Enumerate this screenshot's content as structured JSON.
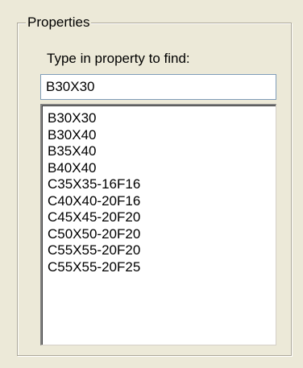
{
  "group": {
    "title": "Properties"
  },
  "search": {
    "prompt": "Type in property to find:",
    "value": "B30X30"
  },
  "list": {
    "items": [
      "B30X30",
      "B30X40",
      "B35X40",
      "B40X40",
      "C35X35-16F16",
      "C40X40-20F16",
      "C45X45-20F20",
      "C50X50-20F20",
      "C55X55-20F20",
      "C55X55-20F25"
    ]
  }
}
